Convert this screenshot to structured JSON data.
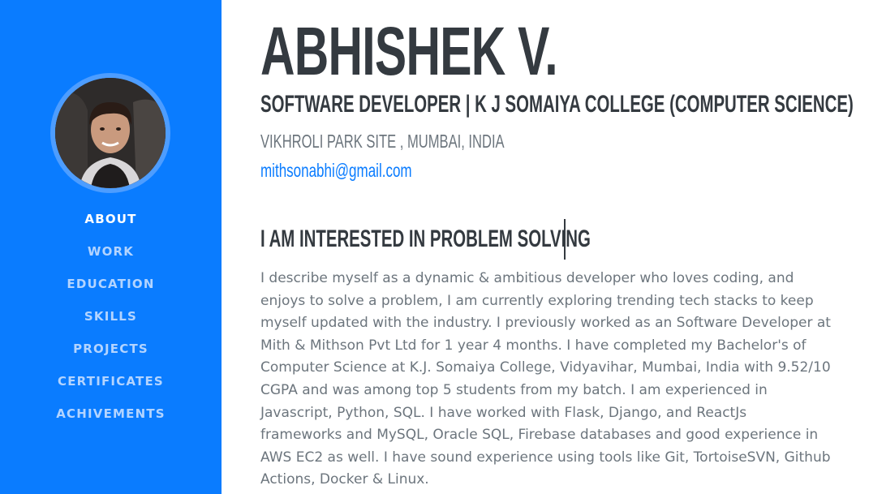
{
  "sidebar": {
    "nav": [
      {
        "label": "ABOUT",
        "active": true
      },
      {
        "label": "WORK",
        "active": false
      },
      {
        "label": "EDUCATION",
        "active": false
      },
      {
        "label": "SKILLS",
        "active": false
      },
      {
        "label": "PROJECTS",
        "active": false
      },
      {
        "label": "CERTIFICATES",
        "active": false
      },
      {
        "label": "ACHIVEMENTS",
        "active": false
      }
    ]
  },
  "profile": {
    "name": "ABHISHEK V.",
    "subheading": "SOFTWARE DEVELOPER | K J SOMAIYA COLLEGE (COMPUTER SCIENCE)",
    "address": "VIKHROLI PARK SITE , MUMBAI, INDIA",
    "email": "mithsonabhi@gmail.com",
    "interest": "I AM INTERESTED IN PROBLEM SOLVING",
    "bio_lines": [
      "I describe myself as a dynamic & ambitious developer who loves coding, and",
      "enjoys to solve a problem, I am currently exploring trending tech stacks to keep",
      "myself updated with the industry. I previously worked as an Software Developer at",
      "Mith & Mithson Pvt Ltd for 1 year 4 months. I have completed my Bachelor's of",
      "Computer Science at K.J. Somaiya College, Vidyavihar, Mumbai, India with 9.52/10",
      "CGPA and was among top 5 students from my batch. I am experienced in",
      "Javascript, Python, SQL. I have worked with Flask, Django, and ReactJs",
      "frameworks and MySQL, Oracle SQL, Firebase databases and good experience in",
      "AWS EC2 as well. I have sound experience using tools like Git, TortoiseSVN, Github",
      "Actions, Docker & Linux."
    ]
  },
  "colors": {
    "sidebar_bg": "#0a7cff",
    "nav_inactive": "#b3d4ff",
    "nav_active": "#ffffff",
    "heading": "#343a40",
    "muted": "#6c757d",
    "link": "#0a7cff"
  }
}
